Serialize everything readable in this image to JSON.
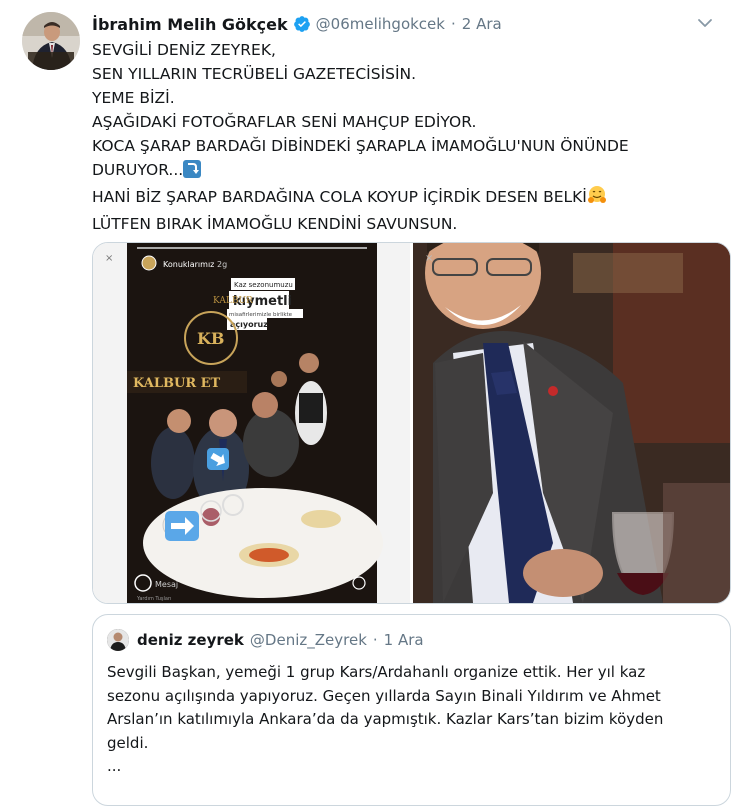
{
  "tweet": {
    "author_name": "İbrahim Melih Gökçek",
    "handle": "@06melihgokcek",
    "separator": "·",
    "date": "2 Ara",
    "lines": [
      "SEVGİLİ DENİZ ZEYREK,",
      "SEN YILLARIN TECRÜBELİ GAZETECİSİSİN.",
      "YEME BİZİ.",
      "AŞAĞIDAKİ FOTOĞRAFLAR SENİ MAHÇUP EDİYOR.",
      "KOCA ŞARAP BARDAĞI DİBİNDEKİ ŞARAPLA İMAMOĞLU'NUN ÖNÜNDE",
      "DURUYOR...",
      "HANİ BİZ ŞARAP BARDAĞINA COLA KOYUP İÇİRDİK DESEN BELKİ",
      "LÜTFEN BIRAK İMAMOĞLU KENDİNİ SAVUNSUN."
    ]
  },
  "media": {
    "left_image": {
      "story_account": "Konuklarımız",
      "story_time": "2g",
      "sticker_line1": "Kaz sezonumuzu",
      "sticker_line2": "kıymetli",
      "sticker_line3": "misafirlerimizle birlikte",
      "sticker_line4": "açıyoruz",
      "restaurant_sign": "KALBUR ET",
      "logo_text": "KALBUR",
      "logo_letters": "KB",
      "bottom_caption": "Mesaj",
      "bottom_caption_small": "Yardım Tuşları"
    }
  },
  "quoted_tweet": {
    "author_name": "deniz zeyrek",
    "handle": "@Deniz_Zeyrek",
    "separator": "·",
    "date": "1 Ara",
    "lines": [
      "Sevgili Başkan, yemeği 1 grup Kars/Ardahanlı organize ettik. Her yıl kaz",
      "sezonu açılışında yapıyoruz. Geçen yıllarda Sayın Binali Yıldırım ve Ahmet",
      "Arslan’ın katılımıyla Ankara’da da yapmıştık. Kazlar Kars’tan bizim köyden",
      "geldi.",
      "..."
    ]
  },
  "colors": {
    "verified_blue": "#1da1f2",
    "secondary_text": "#657786",
    "border": "#ccd6dd"
  },
  "icons": {
    "verified": "verified-badge-icon",
    "menu": "chevron-down-icon",
    "down_arrow_emoji": "right-arrow-curving-down-emoji",
    "hug_emoji": "hugging-face-emoji"
  }
}
